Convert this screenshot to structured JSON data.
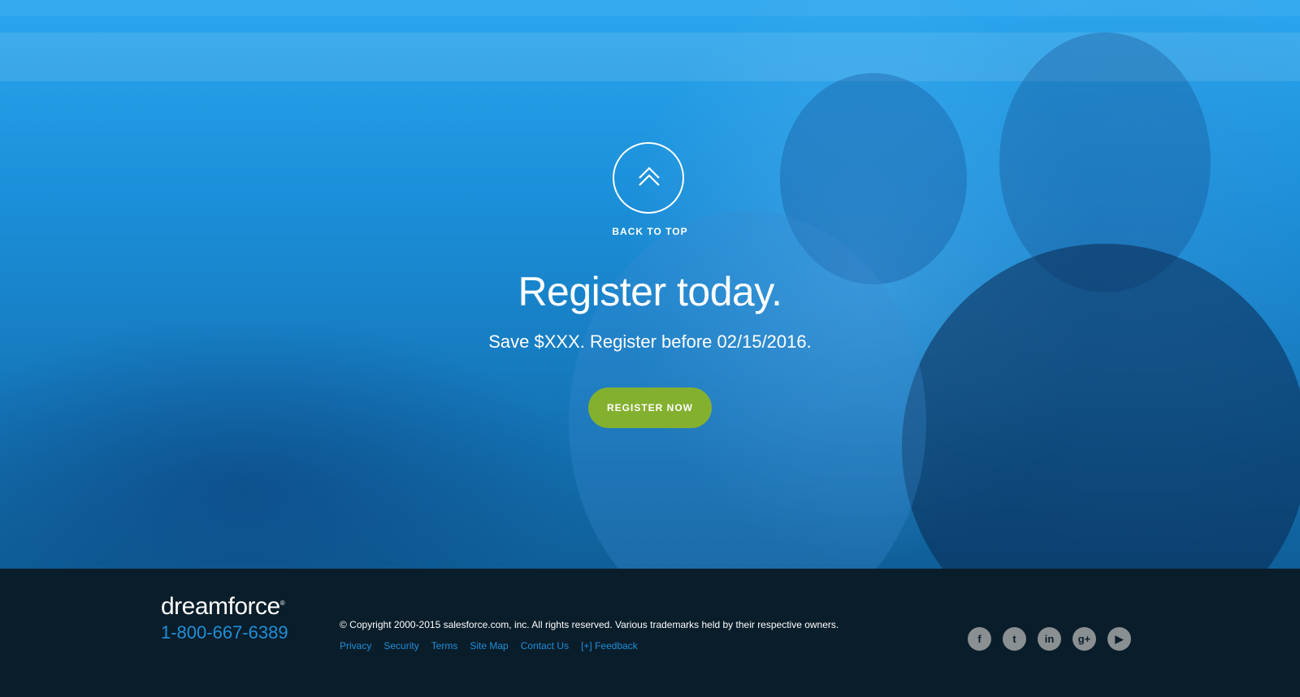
{
  "hero": {
    "back_to_top_label": "BACK TO TOP",
    "headline": "Register today.",
    "subline": "Save $XXX. Register before 02/15/2016.",
    "register_button_label": "REGISTER NOW",
    "colors": {
      "button": "#84b030",
      "overlay": "#1b8fd9"
    }
  },
  "footer": {
    "logo_text": "dreamforce",
    "logo_mark": "®",
    "phone": "1-800-667-6389",
    "copyright": "© Copyright 2000-2015 salesforce.com, inc. All rights reserved. Various trademarks held by their respective owners.",
    "links": [
      "Privacy",
      "Security",
      "Terms",
      "Site Map",
      "Contact Us",
      "[+] Feedback"
    ],
    "social": [
      {
        "name": "facebook-icon",
        "glyph": "f"
      },
      {
        "name": "twitter-icon",
        "glyph": "t"
      },
      {
        "name": "linkedin-icon",
        "glyph": "in"
      },
      {
        "name": "google-plus-icon",
        "glyph": "g+"
      },
      {
        "name": "youtube-icon",
        "glyph": "▶"
      }
    ],
    "colors": {
      "background": "#0a1d2a",
      "link": "#1f8fd8",
      "icon": "#8a8f92"
    }
  }
}
